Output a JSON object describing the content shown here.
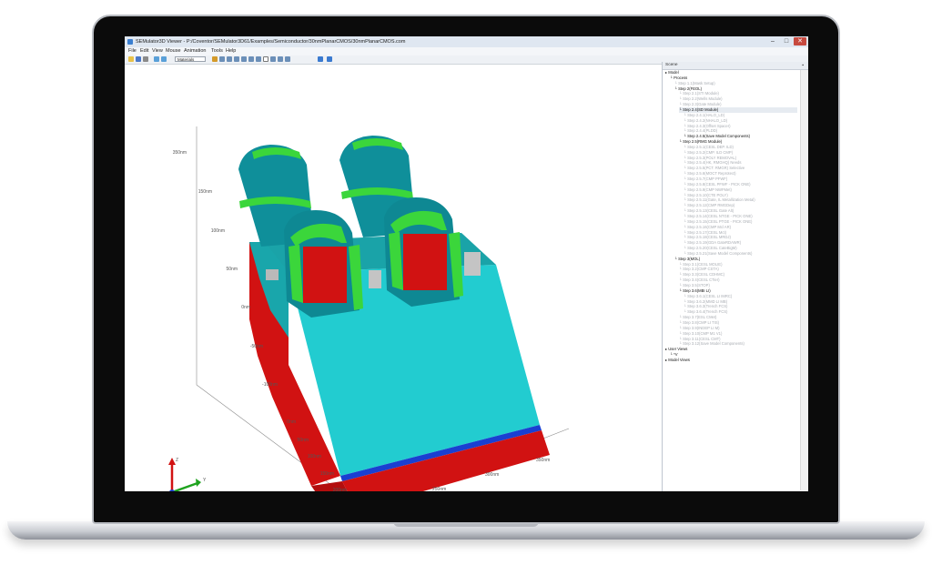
{
  "window": {
    "title": "SEMulator3D Viewer - P:/Coventor/SEMulator3D61/Examples/Semiconductor/30nmPlanarCMOS/30nmPlanarCMOS.com",
    "minimize": "–",
    "maximize": "□",
    "close": "✕"
  },
  "menu": [
    "File",
    "Edit",
    "View",
    "Mouse",
    "Animation",
    "Tools",
    "Help"
  ],
  "toolbar": {
    "view_select": "Materials"
  },
  "scene": {
    "header": "Scene",
    "tree": [
      {
        "label": "Model",
        "indent": 0,
        "state": "normal"
      },
      {
        "label": "Process",
        "indent": 1,
        "state": "normal"
      },
      {
        "label": "Step 1.1(Mask Setup)",
        "indent": 2,
        "state": "grey"
      },
      {
        "label": "Step 2(FEOL)",
        "indent": 2,
        "state": "normal"
      },
      {
        "label": "Step 2.1(STI Module)",
        "indent": 3,
        "state": "grey"
      },
      {
        "label": "Step 2.2(Wells Module)",
        "indent": 3,
        "state": "grey"
      },
      {
        "label": "Step 2.3(Gate Module)",
        "indent": 3,
        "state": "grey"
      },
      {
        "label": "Step 2.4(SD Module)",
        "indent": 3,
        "state": "highlight"
      },
      {
        "label": "Step 2.4.1(HALO_LD)",
        "indent": 4,
        "state": "grey"
      },
      {
        "label": "Step 2.4.2(NHALO_LD)",
        "indent": 4,
        "state": "grey"
      },
      {
        "label": "Step 2.4.3(Offset Spacer)",
        "indent": 4,
        "state": "grey"
      },
      {
        "label": "Step 2.4.4(PLDD)",
        "indent": 4,
        "state": "grey"
      },
      {
        "label": "Step 2.4.5(Save Model Components)",
        "indent": 4,
        "state": "normal"
      },
      {
        "label": "Step 2.5(RMG Module)",
        "indent": 3,
        "state": "normal"
      },
      {
        "label": "Step 2.5.1(CESL DEP. ILD)",
        "indent": 4,
        "state": "grey"
      },
      {
        "label": "Step 2.5.2(CMP. ILD CMP)",
        "indent": 4,
        "state": "grey"
      },
      {
        "label": "Step 2.5.3(POLY REMOVAL)",
        "indent": 4,
        "state": "grey"
      },
      {
        "label": "Step 2.5.4(HK, RMGHQ) Needs",
        "indent": 4,
        "state": "grey"
      },
      {
        "label": "Step 2.5.5(PCT. RMGR) Selective",
        "indent": 4,
        "state": "grey"
      },
      {
        "label": "Step 2.5.6(MOCT Reprotect)",
        "indent": 4,
        "state": "grey"
      },
      {
        "label": "Step 2.5.7(CMP PFWF)",
        "indent": 4,
        "state": "grey"
      },
      {
        "label": "Step 2.5.8(CESL PFWF - PICK ONE)",
        "indent": 4,
        "state": "grey"
      },
      {
        "label": "Step 2.5.9(CMP NWFMet)",
        "indent": 4,
        "state": "grey"
      },
      {
        "label": "Step 2.5.10(CTE POLY)",
        "indent": 4,
        "state": "grey"
      },
      {
        "label": "Step 2.5.11(Gate, IL Metallization Metal)",
        "indent": 4,
        "state": "grey"
      },
      {
        "label": "Step 2.5.12(CMP RMGDep)",
        "indent": 4,
        "state": "grey"
      },
      {
        "label": "Step 2.5.13(CESL Gate Alt)",
        "indent": 4,
        "state": "grey"
      },
      {
        "label": "Step 2.5.14(CESL NTGE - PICK ONE)",
        "indent": 4,
        "state": "grey"
      },
      {
        "label": "Step 2.5.15(CESL PTGE - PICK ONE)",
        "indent": 4,
        "state": "grey"
      },
      {
        "label": "Step 2.5.16(CMP Mcl AR)",
        "indent": 4,
        "state": "grey"
      },
      {
        "label": "Step 2.5.17(CESL Mct)",
        "indent": 4,
        "state": "grey"
      },
      {
        "label": "Step 2.5.18(CESL MRDJ)",
        "indent": 4,
        "state": "grey"
      },
      {
        "label": "Step 2.5.19(GDA GateRDAWR)",
        "indent": 4,
        "state": "grey"
      },
      {
        "label": "Step 2.5.20(CESL CateBigM)",
        "indent": 4,
        "state": "grey"
      },
      {
        "label": "Step 2.5.21(Save Model Components)",
        "indent": 4,
        "state": "grey"
      },
      {
        "label": "Step 3(MOL)",
        "indent": 2,
        "state": "normal"
      },
      {
        "label": "Step 3.1(CESL MOLIE)",
        "indent": 3,
        "state": "grey"
      },
      {
        "label": "Step 3.2(CMP CSTA)",
        "indent": 3,
        "state": "grey"
      },
      {
        "label": "Step 3.3(CESL CDHMC)",
        "indent": 3,
        "state": "grey"
      },
      {
        "label": "Step 3.4(CESL CTier)",
        "indent": 3,
        "state": "grey"
      },
      {
        "label": "Step 3.5(STOP)",
        "indent": 3,
        "state": "grey"
      },
      {
        "label": "Step 3.6(MBI LI)",
        "indent": 3,
        "state": "normal"
      },
      {
        "label": "Step 3.6.1(CESL LI IMRC)",
        "indent": 4,
        "state": "grey"
      },
      {
        "label": "Step 3.6.2(MMD LI MB)",
        "indent": 4,
        "state": "grey"
      },
      {
        "label": "Step 3.6.3(Trench FCS)",
        "indent": 4,
        "state": "grey"
      },
      {
        "label": "Step 3.6.4(Trench FCS)",
        "indent": 4,
        "state": "grey"
      },
      {
        "label": "Step 3.7(ESL CMet)",
        "indent": 3,
        "state": "grey"
      },
      {
        "label": "Step 3.8(CMP LI TIS)",
        "indent": 3,
        "state": "grey"
      },
      {
        "label": "Step 3.9(INDEP LI M)",
        "indent": 3,
        "state": "grey"
      },
      {
        "label": "Step 3.10(CMP M1 V1)",
        "indent": 3,
        "state": "grey"
      },
      {
        "label": "Step 3.11(CESL CMT)",
        "indent": 3,
        "state": "grey"
      },
      {
        "label": "Step 3.12(Save Model Components)",
        "indent": 3,
        "state": "grey"
      },
      {
        "label": "User Views",
        "indent": 0,
        "state": "normal"
      },
      {
        "label": "*V",
        "indent": 1,
        "state": "normal"
      },
      {
        "label": "Model Views",
        "indent": 0,
        "state": "normal"
      }
    ]
  },
  "viewport": {
    "z_axis_labels": [
      "350nm",
      "150nm",
      "100nm",
      "50nm",
      "0nm",
      "-50nm",
      "-100nm"
    ],
    "y_axis_labels": [
      "0nm",
      "50nm",
      "100nm",
      "150nm",
      "200nm",
      "350nm"
    ],
    "x_axis_labels": [
      "200nm",
      "250nm",
      "300nm",
      "350nm"
    ],
    "triad": {
      "z": "Z",
      "y": "Y",
      "x": "X"
    },
    "colors": {
      "cyan": "#21c9cc",
      "teal": "#0f8f9a",
      "green": "#3bd63b",
      "red": "#d11212",
      "blue": "#1a3fd1",
      "grey": "#b9b9b9"
    }
  }
}
